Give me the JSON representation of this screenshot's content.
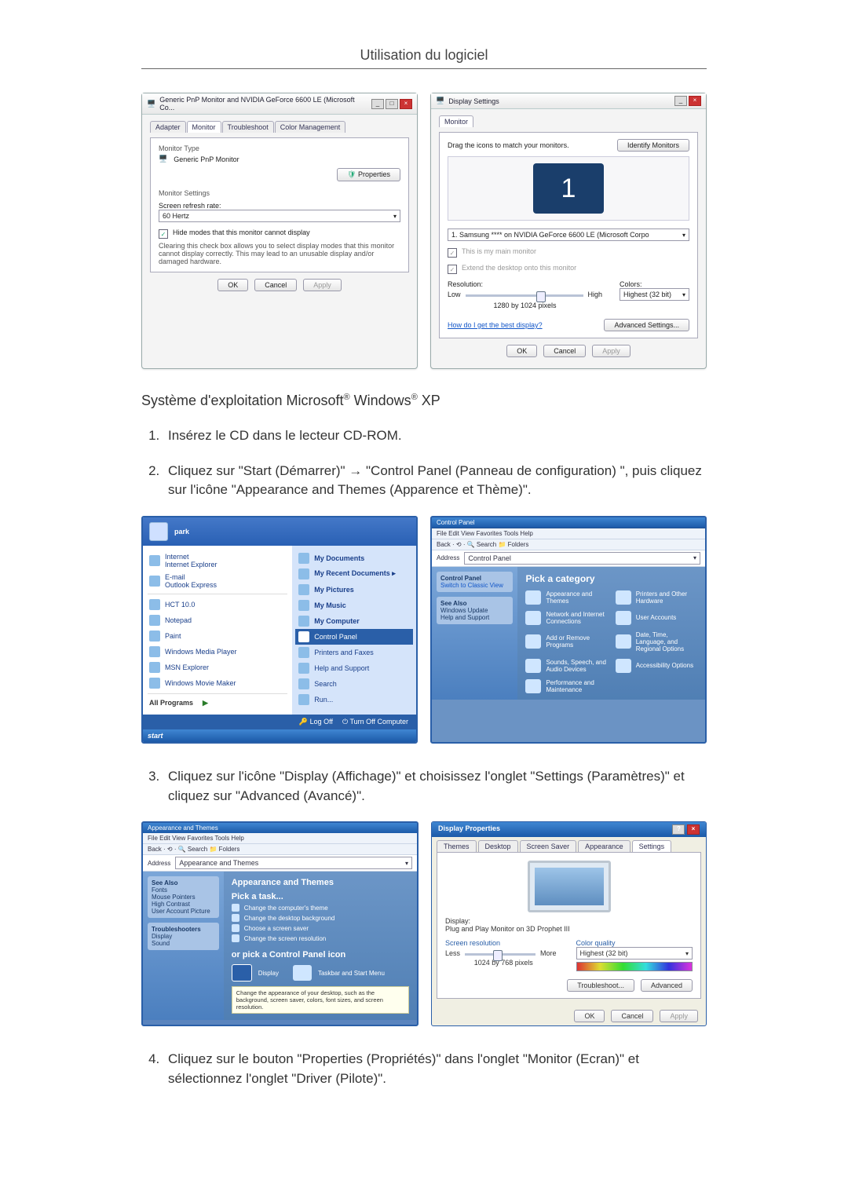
{
  "header": {
    "title": "Utilisation du logiciel"
  },
  "fig1": {
    "left": {
      "title": "Generic PnP Monitor and NVIDIA GeForce 6600 LE (Microsoft Co...",
      "tabs": [
        "Adapter",
        "Monitor",
        "Troubleshoot",
        "Color Management"
      ],
      "active_tab_index": 1,
      "monitor_type_label": "Monitor Type",
      "monitor_type_value": "Generic PnP Monitor",
      "properties_btn": "Properties",
      "monitor_settings_label": "Monitor Settings",
      "refresh_rate_label": "Screen refresh rate:",
      "refresh_rate_value": "60 Hertz",
      "hide_modes_checkbox": "Hide modes that this monitor cannot display",
      "hide_modes_desc": "Clearing this check box allows you to select display modes that this monitor cannot display correctly. This may lead to an unusable display and/or damaged hardware.",
      "buttons": {
        "ok": "OK",
        "cancel": "Cancel",
        "apply": "Apply"
      }
    },
    "right": {
      "title": "Display Settings",
      "tab": "Monitor",
      "drag_text": "Drag the icons to match your monitors.",
      "identify_btn": "Identify Monitors",
      "monitor_number": "1",
      "device_dropdown": "1. Samsung **** on NVIDIA GeForce 6600 LE (Microsoft Corpo",
      "main_monitor_cb": "This is my main monitor",
      "extend_cb": "Extend the desktop onto this monitor",
      "resolution_label": "Resolution:",
      "res_low": "Low",
      "res_high": "High",
      "res_value": "1280 by 1024 pixels",
      "colors_label": "Colors:",
      "colors_value": "Highest (32 bit)",
      "help_link": "How do I get the best display?",
      "adv_btn": "Advanced Settings...",
      "buttons": {
        "ok": "OK",
        "cancel": "Cancel",
        "apply": "Apply"
      }
    }
  },
  "os_line": {
    "prefix": "Système d'exploitation Microsoft",
    "mid": " Windows",
    "suffix": " XP"
  },
  "steps": [
    "Insérez le CD dans le lecteur CD-ROM.",
    "Cliquez sur \"Start (Démarrer)\" → \"Control Panel (Panneau de configuration) \", puis cliquez sur l'icône \"Appearance and Themes (Apparence et Thème)\".",
    "Cliquez sur l'icône \"Display (Affichage)\" et choisissez l'onglet \"Settings (Paramètres)\" et cliquez sur \"Advanced (Avancé)\".",
    "Cliquez sur le bouton \"Properties (Propriétés)\" dans l'onglet \"Monitor (Ecran)\" et sélectionnez l'onglet \"Driver (Pilote)\"."
  ],
  "fig2": {
    "startmenu": {
      "user": "park",
      "left": [
        "Internet\nInternet Explorer",
        "E-mail\nOutlook Express",
        "HCT 10.0",
        "Notepad",
        "Paint",
        "Windows Media Player",
        "MSN Explorer",
        "Windows Movie Maker"
      ],
      "all_programs": "All Programs",
      "right": [
        "My Documents",
        "My Recent Documents  ▸",
        "My Pictures",
        "My Music",
        "My Computer",
        "Control Panel",
        "Printers and Faxes",
        "Help and Support",
        "Search",
        "Run..."
      ],
      "highlight_index": 5,
      "footer": {
        "logoff": "Log Off",
        "turnoff": "Turn Off Computer"
      },
      "start": "start"
    },
    "ctrlpanel": {
      "title": "Control Panel",
      "menubar": "File   Edit   View   Favorites   Tools   Help",
      "toolbar": "Back  ·  ⟲  ·  🔍 Search   📁 Folders",
      "address_label": "Address",
      "address_value": "Control Panel",
      "side": {
        "box1_title": "Control Panel",
        "box1_item": "Switch to Classic View",
        "box2_title": "See Also",
        "box2_items": [
          "Windows Update",
          "Help and Support"
        ]
      },
      "heading": "Pick a category",
      "categories": [
        "Appearance and Themes",
        "Printers and Other Hardware",
        "Network and Internet Connections",
        "User Accounts",
        "Add or Remove Programs",
        "Date, Time, Language, and Regional Options",
        "Sounds, Speech, and Audio Devices",
        "Accessibility Options",
        "Performance and Maintenance"
      ]
    }
  },
  "fig3": {
    "appthemes": {
      "title": "Appearance and Themes",
      "menubar": "File   Edit   View   Favorites   Tools   Help",
      "toolbar": "Back  ·  ⟲  ·  🔍 Search   📁 Folders",
      "address_label": "Address",
      "address_value": "Appearance and Themes",
      "side": {
        "box1_title": "See Also",
        "box1_items": [
          "Fonts",
          "Mouse Pointers",
          "High Contrast",
          "User Account Picture"
        ],
        "box2_title": "Troubleshooters",
        "box2_items": [
          "Display",
          "Sound"
        ]
      },
      "heading1": "Appearance and Themes",
      "task_heading": "Pick a task...",
      "tasks": [
        "Change the computer's theme",
        "Change the desktop background",
        "Choose a screen saver",
        "Change the screen resolution"
      ],
      "cp_heading": "or pick a Control Panel icon",
      "cp_icons": [
        "Display",
        "Taskbar and Start Menu"
      ],
      "cp_desc": "Change the appearance of your desktop, such as the background, screen saver, colors, font sizes, and screen resolution."
    },
    "dispprops": {
      "title": "Display Properties",
      "tabs": [
        "Themes",
        "Desktop",
        "Screen Saver",
        "Appearance",
        "Settings"
      ],
      "active_tab_index": 4,
      "display_label": "Display:",
      "display_value": "Plug and Play Monitor on 3D Prophet III",
      "res_label": "Screen resolution",
      "res_less": "Less",
      "res_more": "More",
      "res_value": "1024 by 768 pixels",
      "color_label": "Color quality",
      "color_value": "Highest (32 bit)",
      "troubleshoot": "Troubleshoot...",
      "advanced": "Advanced",
      "buttons": {
        "ok": "OK",
        "cancel": "Cancel",
        "apply": "Apply"
      }
    }
  }
}
